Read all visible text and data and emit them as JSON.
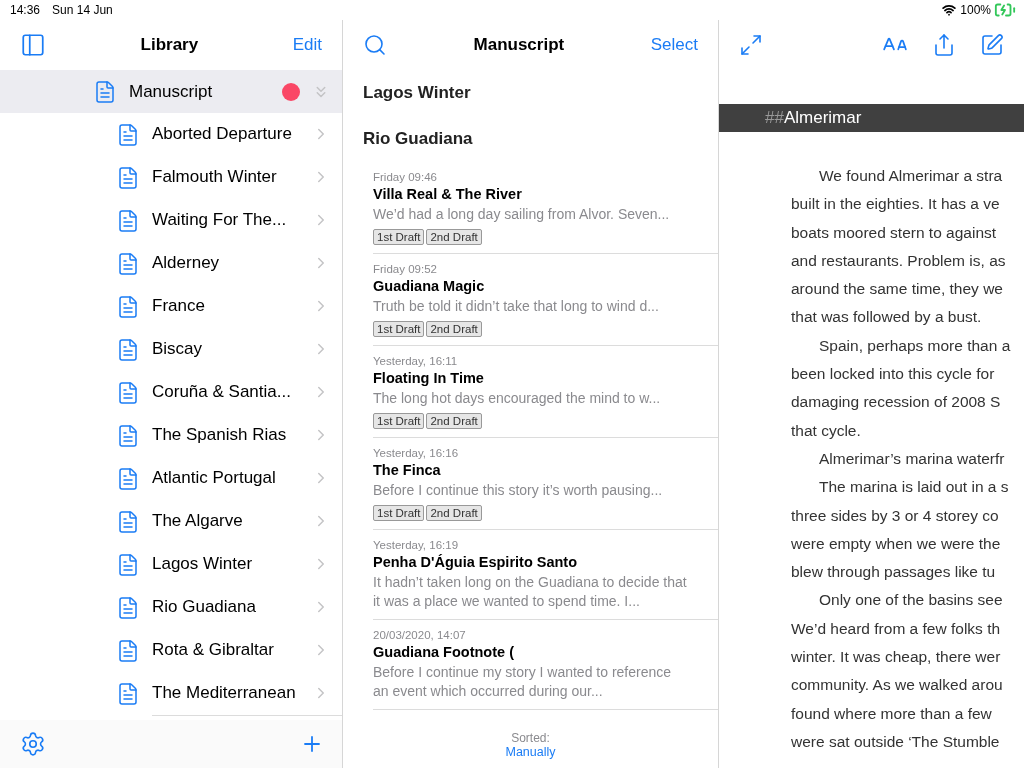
{
  "status_bar": {
    "time": "14:36",
    "date": "Sun 14 Jun",
    "battery": "100%"
  },
  "sidebar": {
    "title": "Library",
    "edit": "Edit",
    "root": {
      "label": "Manuscript",
      "color": "#fa4766",
      "selected": true,
      "expanded": true,
      "children": [
        {
          "label": "Aborted Departure",
          "selected": false
        },
        {
          "label": "Falmouth Winter",
          "selected": false
        },
        {
          "label": "Waiting For The...",
          "selected": false
        },
        {
          "label": "Alderney",
          "selected": false
        },
        {
          "label": "France",
          "selected": false
        },
        {
          "label": "Biscay",
          "selected": false
        },
        {
          "label": "Coruña & Santia...",
          "selected": false
        },
        {
          "label": "The Spanish Rias",
          "selected": false
        },
        {
          "label": "Atlantic Portugal",
          "selected": false
        },
        {
          "label": "The Algarve",
          "selected": false
        },
        {
          "label": "Lagos Winter",
          "selected": false
        },
        {
          "label": "Rio Guadiana",
          "selected": false
        },
        {
          "label": "Rota & Gibraltar",
          "selected": false
        },
        {
          "label": "The Mediterranean",
          "selected": false
        }
      ]
    }
  },
  "document_list": {
    "title": "Manuscript",
    "action": "Select",
    "groups": [
      "Lagos Winter",
      "Rio Guadiana"
    ],
    "documents": [
      {
        "date": "Friday 09:46",
        "title": "Villa Real & The River",
        "preview": "We’d had a long day sailing from Alvor. Seven...",
        "tags": [
          "1st Draft",
          "2nd Draft"
        ]
      },
      {
        "date": "Friday 09:52",
        "title": "Guadiana Magic",
        "preview": "Truth be told it didn’t take that long to wind d...",
        "tags": [
          "1st Draft",
          "2nd Draft"
        ]
      },
      {
        "date": "Yesterday, 16:11",
        "title": "Floating In Time",
        "preview": "The long hot days encouraged the mind to w...",
        "tags": [
          "1st Draft",
          "2nd Draft"
        ]
      },
      {
        "date": "Yesterday, 16:16",
        "title": "The Finca",
        "preview": "Before I continue this story it’s worth pausing...",
        "tags": [
          "1st Draft",
          "2nd Draft"
        ]
      },
      {
        "date": "Yesterday, 16:19",
        "title": "Penha D'Águia Espirito Santo",
        "preview": "It hadn’t taken long on the Guadiana to decide that it was a place we wanted to spend time. I..."
      },
      {
        "date": "20/03/2020, 14:07",
        "title": "Guadiana Footnote (",
        "preview": "Before I continue my story I wanted to reference an event which occurred during our..."
      }
    ],
    "sort_label": "Sorted:",
    "sort_value": "Manually"
  },
  "editor": {
    "heading_marker": "##",
    "heading": "Almerimar",
    "lines": [
      {
        "text": "We found Almerimar a stra",
        "indent": true
      },
      {
        "text": "built in the eighties. It has a ve",
        "indent": false
      },
      {
        "text": "boats moored stern to against",
        "indent": false
      },
      {
        "text": "and restaurants. Problem is, as",
        "indent": false
      },
      {
        "text": "around the same time, they we",
        "indent": false
      },
      {
        "text": "that was followed by a bust.",
        "indent": false
      },
      {
        "text": "Spain, perhaps more than a",
        "indent": true
      },
      {
        "text": "been locked into this cycle for",
        "indent": false
      },
      {
        "text": "damaging recession of 2008 S",
        "indent": false
      },
      {
        "text": "that cycle.",
        "indent": false
      },
      {
        "text": "Almerimar’s marina waterfr",
        "indent": true
      },
      {
        "text": "The marina is laid out in a s",
        "indent": true
      },
      {
        "text": "three sides by 3 or 4 storey co",
        "indent": false
      },
      {
        "text": "were empty when we were the",
        "indent": false
      },
      {
        "text": "blew through passages like tu",
        "indent": false
      },
      {
        "text": "Only one of the basins see",
        "indent": true
      },
      {
        "text": "We’d heard from a few folks th",
        "indent": false
      },
      {
        "text": "winter. It was cheap, there wer",
        "indent": false
      },
      {
        "text": "community. As we walked arou",
        "indent": false
      },
      {
        "text": "found where more than a few",
        "indent": false
      },
      {
        "text": "were sat outside ‘The Stumble",
        "indent": false
      }
    ]
  }
}
